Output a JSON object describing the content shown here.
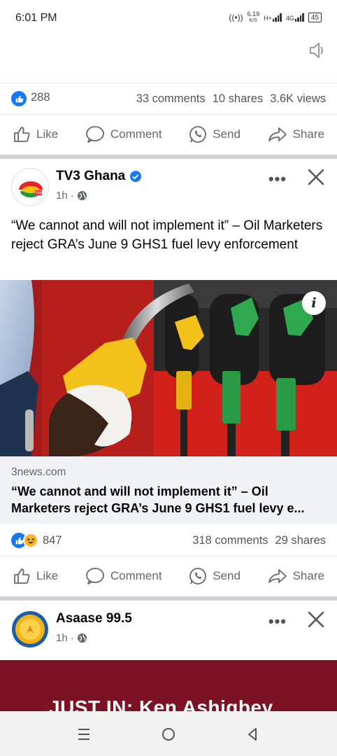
{
  "status_bar": {
    "time": "6:01 PM",
    "net_speed_top": "6.19",
    "net_speed_bottom": "K/S",
    "network_1": "H+",
    "network_2": "4G",
    "battery": "45"
  },
  "post1": {
    "reactions_count": "288",
    "comments": "33 comments",
    "shares": "10 shares",
    "views": "3.6K views"
  },
  "actions": {
    "like": "Like",
    "comment": "Comment",
    "send": "Send",
    "share": "Share"
  },
  "post2": {
    "page_name": "TV3 Ghana",
    "avatar_text": "TV3",
    "time": "1h",
    "text": "“We cannot and will not implement it” – Oil Marketers reject GRA’s June 9 GHS1 fuel levy enforcement",
    "link_domain": "3news.com",
    "link_title_line1": "“We cannot and will not implement it” – Oil",
    "link_title_line2": "Marketers reject GRA’s June 9 GHS1 fuel levy e...",
    "reactions_count": "847",
    "comments": "318 comments",
    "shares": "29 shares"
  },
  "post3": {
    "page_name": "Asaase 99.5",
    "time": "1h",
    "banner_text": "JUST IN: Ken Ashigbey"
  },
  "colors": {
    "facebook_blue": "#1877f2",
    "verified_blue": "#1877f2",
    "banner_red": "#7b1324",
    "secondary_text": "#65676b"
  }
}
